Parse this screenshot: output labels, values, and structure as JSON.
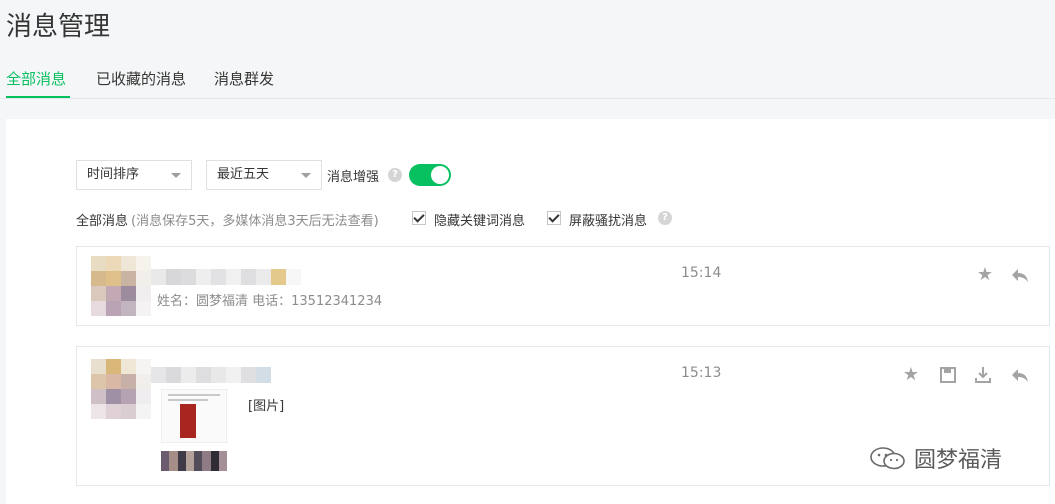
{
  "page": {
    "title": "消息管理"
  },
  "tabs": [
    {
      "label": "全部消息",
      "active": true
    },
    {
      "label": "已收藏的消息",
      "active": false
    },
    {
      "label": "消息群发",
      "active": false
    }
  ],
  "filters": {
    "sort": {
      "selected": "时间排序"
    },
    "range": {
      "selected": "最近五天"
    },
    "enhance": {
      "label": "消息增强",
      "enabled": true
    }
  },
  "info": {
    "title": "全部消息",
    "note": "(消息保存5天，多媒体消息3天后无法查看)",
    "hide_keyword": {
      "label": "隐藏关键词消息",
      "checked": true
    },
    "block_spam": {
      "label": "屏蔽骚扰消息",
      "checked": true
    }
  },
  "messages": [
    {
      "time": "15:14",
      "text": "姓名：圆梦福清 电话：13512341234"
    },
    {
      "time": "15:13",
      "text": "[图片]"
    }
  ],
  "watermark": {
    "text": "圆梦福清"
  },
  "colors": {
    "accent": "#07c160",
    "muted": "#8c8c8c"
  }
}
